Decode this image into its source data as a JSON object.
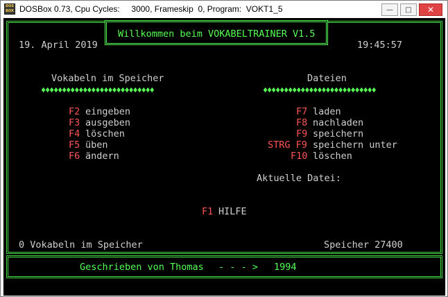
{
  "window": {
    "icon_text": "DOS BOX",
    "title": "DOSBox 0.73, Cpu Cycles:     3000, Frameskip  0, Program:  VOKT1_5",
    "minimize_label": "—",
    "maximize_label": "□",
    "close_label": "✕"
  },
  "screen": {
    "header_title": "Willkommen beim VOKABELTRAINER V1.5",
    "date": "19. April 2019",
    "time": "19:45:57",
    "left_section": {
      "heading": "Vokabeln im Speicher",
      "divider": "♦♦♦♦♦♦♦♦♦♦♦♦♦♦♦♦♦♦♦♦♦♦♦♦♦♦♦",
      "items": [
        {
          "key": "F2",
          "label": "eingeben"
        },
        {
          "key": "F3",
          "label": "ausgeben"
        },
        {
          "key": "F4",
          "label": "löschen"
        },
        {
          "key": "F5",
          "label": "üben"
        },
        {
          "key": "F6",
          "label": "ändern"
        }
      ]
    },
    "right_section": {
      "heading": "Dateien",
      "divider": "♦♦♦♦♦♦♦♦♦♦♦♦♦♦♦♦♦♦♦♦♦♦♦♦♦♦♦",
      "items": [
        {
          "key": "F7",
          "label": "laden"
        },
        {
          "key": "F8",
          "label": "nachladen"
        },
        {
          "key": "F9",
          "label": "speichern"
        },
        {
          "key": "STRG F9",
          "label": "speichern unter"
        },
        {
          "key": "F10",
          "label": "löschen"
        }
      ],
      "current_file_label": "Aktuelle Datei:"
    },
    "help": {
      "key": "F1",
      "label": "HILFE"
    },
    "status_left": "0 Vokabeln im Speicher",
    "status_right": "Speicher 27400",
    "footer": {
      "author": "Geschrieben von Thomas",
      "arrow": "- - - >",
      "year": "1994"
    }
  },
  "colors": {
    "green": "#55ff55",
    "red": "#ff5555",
    "gray": "#d0d0d0",
    "background": "#000000"
  }
}
